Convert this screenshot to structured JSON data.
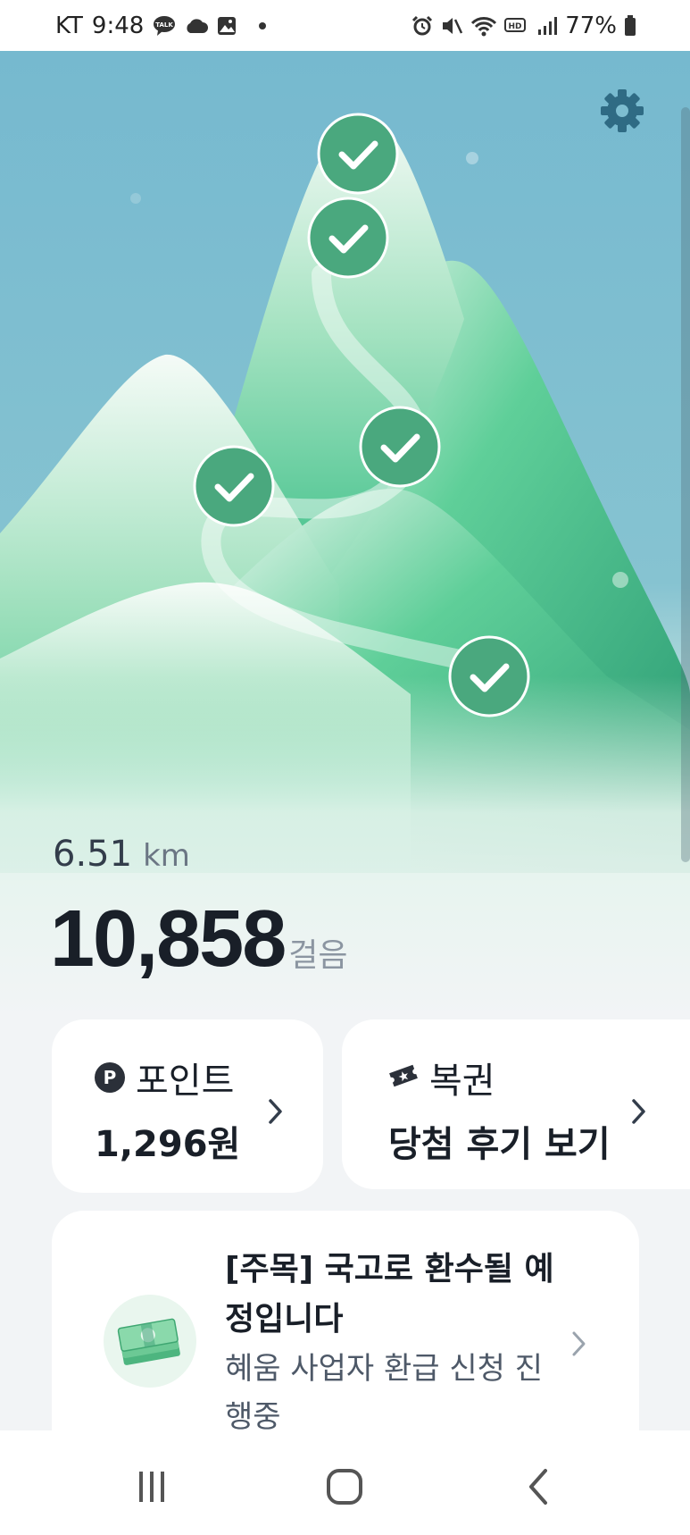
{
  "status_bar": {
    "carrier": "KT",
    "time": "9:48",
    "battery": "77%",
    "left_icons": [
      "talk-icon",
      "cloud-icon",
      "gallery-icon",
      "dot-icon"
    ],
    "right_icons": [
      "alarm-icon",
      "mute-icon",
      "wifi-icon",
      "hd-icon",
      "signal-icon",
      "battery-icon"
    ]
  },
  "hero": {
    "checkpoints_completed": 5,
    "settings_icon": "gear-icon"
  },
  "stats": {
    "distance_value": "6.51",
    "distance_unit": "km",
    "steps_value": "10,858",
    "steps_unit": "걸음"
  },
  "points_card": {
    "icon": "p-icon",
    "icon_letter": "P",
    "title": "포인트",
    "value": "1,296원"
  },
  "lotto_card": {
    "icon": "ticket-icon",
    "title": "복권",
    "value": "당첨 후기 보기"
  },
  "notice_card": {
    "icon": "money-icon",
    "title": "[주목] 국고로 환수될 예정입니다",
    "subtitle": "혜움 사업자 환급 신청 진행중"
  },
  "nav_bar": {
    "buttons": [
      "recents-button",
      "home-button",
      "back-button"
    ]
  },
  "colors": {
    "sky": "#7dbdd0",
    "mountain_green": "#3cc08a",
    "checkpoint": "#4aa87e",
    "background": "#f2f4f6"
  }
}
